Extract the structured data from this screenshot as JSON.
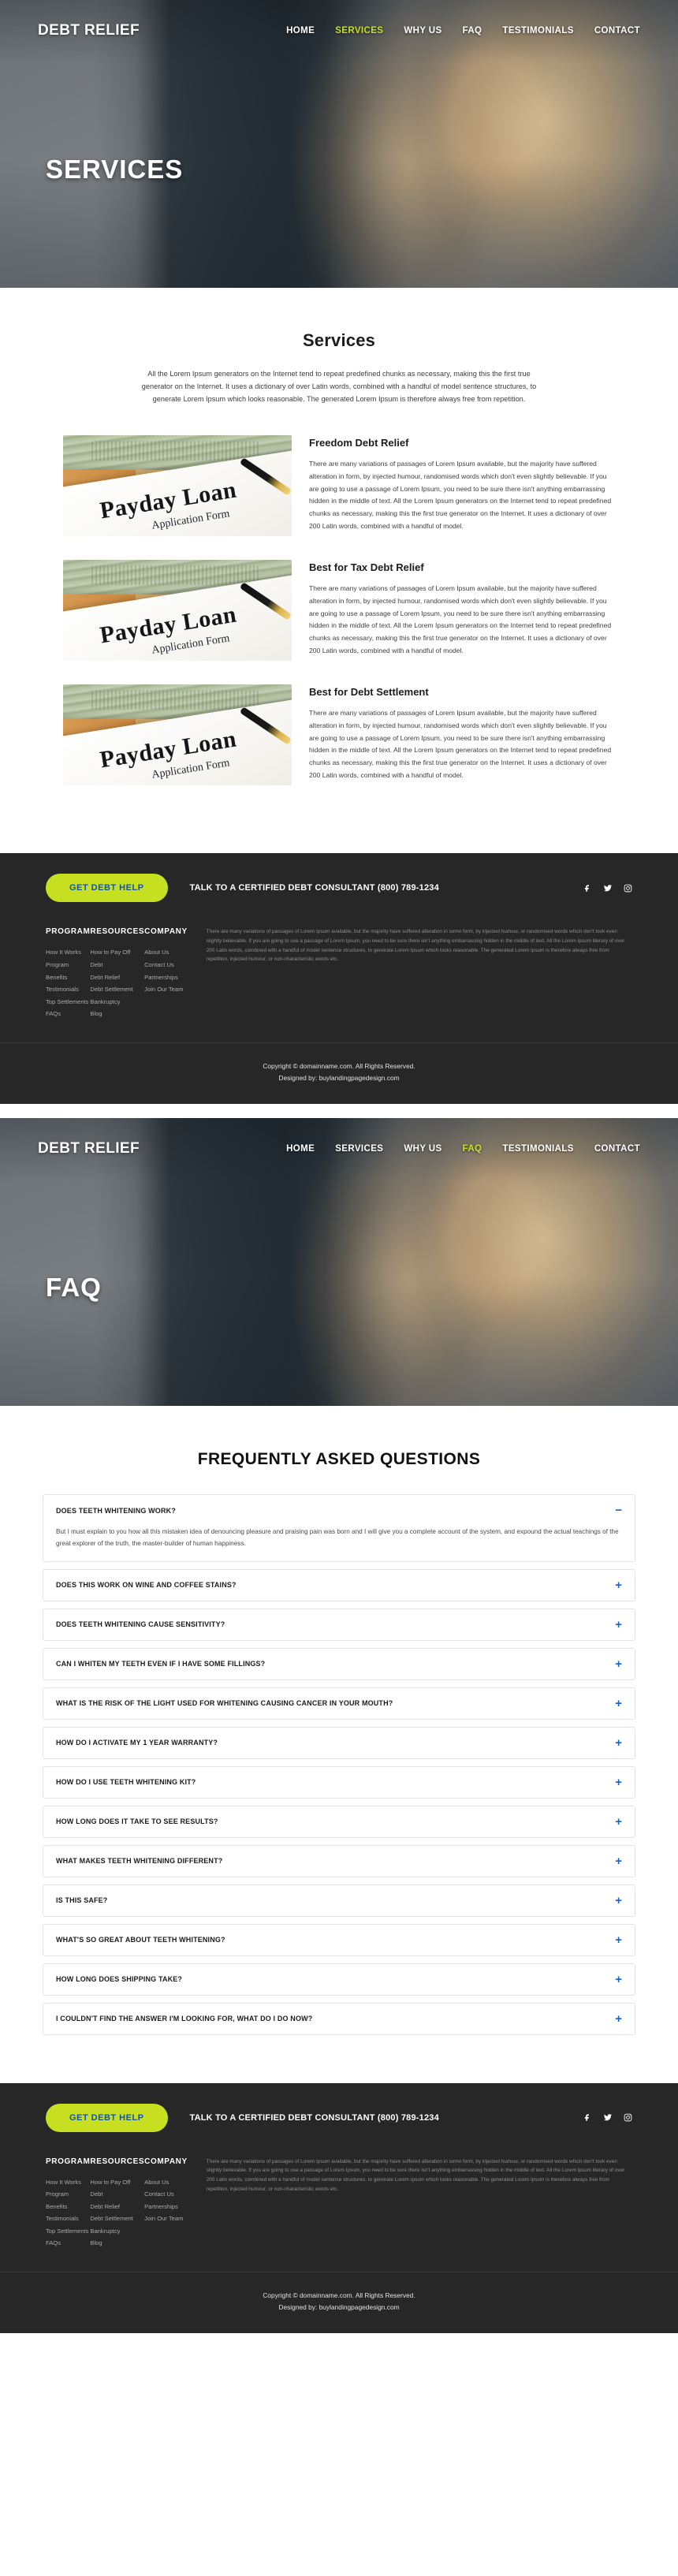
{
  "brand": {
    "logo": "DEBT RELIEF",
    "accent_color": "#c6e021",
    "link_color": "#1266d4"
  },
  "nav": {
    "items": [
      {
        "label": "HOME",
        "active": false
      },
      {
        "label": "SERVICES",
        "active": true
      },
      {
        "label": "WHY US",
        "active": false
      },
      {
        "label": "FAQ",
        "active": false
      },
      {
        "label": "TESTIMONIALS",
        "active": false
      },
      {
        "label": "CONTACT",
        "active": false
      }
    ]
  },
  "nav_faq": {
    "items": [
      {
        "label": "HOME",
        "active": false
      },
      {
        "label": "SERVICES",
        "active": false
      },
      {
        "label": "WHY US",
        "active": false
      },
      {
        "label": "FAQ",
        "active": true
      },
      {
        "label": "TESTIMONIALS",
        "active": false
      },
      {
        "label": "CONTACT",
        "active": false
      }
    ]
  },
  "hero_services": {
    "title": "SERVICES"
  },
  "hero_faq": {
    "title": "FAQ"
  },
  "services": {
    "heading": "Services",
    "intro": "All the Lorem Ipsum generators on the Internet tend to repeat predefined chunks as necessary, making this the first true generator on the Internet. It uses a dictionary of over Latin words, combined with a handful of model sentence structures, to generate Lorem Ipsum which looks reasonable. The generated Lorem Ipsum is therefore always free from repetition.",
    "image_caption_title": "Payday Loan",
    "image_caption_sub": "Application Form",
    "items": [
      {
        "title": "Freedom Debt Relief",
        "text": "There are many variations of passages of Lorem Ipsum available, but the majority have suffered alteration in form, by injected humour, randomised words which don't even slightly believable. If you are going to use a passage of Lorem Ipsum, you need to be sure there isn't anything embarrassing hidden in the middle of text. All the Lorem Ipsum generators on the Internet tend to repeat predefined chunks as necessary, making this the first true generator on the Internet. It uses a dictionary of over 200 Latin words, combined with a handful of model."
      },
      {
        "title": "Best for Tax Debt Relief",
        "text": "There are many variations of passages of Lorem Ipsum available, but the majority have suffered alteration in form, by injected humour, randomised words which don't even slightly believable. If you are going to use a passage of Lorem Ipsum, you need to be sure there isn't anything embarrassing hidden in the middle of text. All the Lorem Ipsum generators on the Internet tend to repeat predefined chunks as necessary, making this the first true generator on the Internet. It uses a dictionary of over 200 Latin words, combined with a handful of model."
      },
      {
        "title": "Best for Debt Settlement",
        "text": "There are many variations of passages of Lorem Ipsum available, but the majority have suffered alteration in form, by injected humour, randomised words which don't even slightly believable. If you are going to use a passage of Lorem Ipsum, you need to be sure there isn't anything embarrassing hidden in the middle of text. All the Lorem Ipsum generators on the Internet tend to repeat predefined chunks as necessary, making this the first true generator on the Internet. It uses a dictionary of over 200 Latin words, combined with a handful of model."
      }
    ]
  },
  "footer": {
    "cta_button": "GET DEBT HELP",
    "cta_text": "TALK TO A CERTIFIED DEBT CONSULTANT",
    "cta_phone": "(800) 789-1234",
    "socials": [
      {
        "name": "facebook-icon"
      },
      {
        "name": "twitter-icon"
      },
      {
        "name": "instagram-icon"
      }
    ],
    "columns": [
      {
        "title": "PROGRAM",
        "links": [
          "How It Works",
          "Program Benefits",
          "Testimonials",
          "Top Settlements",
          "FAQs"
        ]
      },
      {
        "title": "RESOURCES",
        "links": [
          "How to Pay Off Debt",
          "Debt Relief",
          "Debt Settlement",
          "Bankruptcy",
          "Blog"
        ]
      },
      {
        "title": "COMPANY",
        "links": [
          "About Us",
          "Contact Us",
          "Partnerships",
          "Join Our Team"
        ]
      }
    ],
    "about_text": "There are many variations of passages of Lorem Ipsum available, but the majority have suffered alteration in some form, by injected humour, or randomised words which don't look even slightly believable. If you are going to use a passage of Lorem Ipsum, you need to be sure there isn't anything embarrassing hidden in the middle of text. All the Lorem Ipsum literary of over 200 Latin words, combined with a handful of model sentence structures, to generate Lorem Ipsum which looks reasonable. The generated Lorem Ipsum is therefore always free from repetition, injected humour, or non-characteristic words etc.",
    "copyright_line1": "Copyright © domainname.com. All Rights Reserved.",
    "copyright_line2": "Designed by: buylandingpagedesign.com"
  },
  "faq": {
    "heading": "FREQUENTLY ASKED QUESTIONS",
    "expand_icon": "+",
    "collapse_icon": "−",
    "items": [
      {
        "question": "DOES TEETH WHITENING WORK?",
        "answer": "But I must explain to you how all this mistaken idea of denouncing pleasure and praising pain was born and I will give you a complete account of the system, and expound the actual teachings of the great explorer of the truth, the master-builder of human happiness.",
        "open": true
      },
      {
        "question": "DOES THIS WORK ON WINE AND COFFEE STAINS?",
        "answer": "",
        "open": false
      },
      {
        "question": "DOES TEETH WHITENING CAUSE SENSITIVITY?",
        "answer": "",
        "open": false
      },
      {
        "question": "CAN I WHITEN MY TEETH EVEN IF I HAVE SOME FILLINGS?",
        "answer": "",
        "open": false
      },
      {
        "question": "WHAT IS THE RISK OF THE LIGHT USED FOR WHITENING CAUSING CANCER IN YOUR MOUTH?",
        "answer": "",
        "open": false
      },
      {
        "question": "HOW DO I ACTIVATE MY 1 YEAR WARRANTY?",
        "answer": "",
        "open": false
      },
      {
        "question": "HOW DO I USE TEETH WHITENING KIT?",
        "answer": "",
        "open": false
      },
      {
        "question": "HOW LONG DOES IT TAKE TO SEE RESULTS?",
        "answer": "",
        "open": false
      },
      {
        "question": "WHAT MAKES TEETH WHITENING DIFFERENT?",
        "answer": "",
        "open": false
      },
      {
        "question": "IS THIS SAFE?",
        "answer": "",
        "open": false
      },
      {
        "question": "WHAT'S SO GREAT ABOUT TEETH WHITENING?",
        "answer": "",
        "open": false
      },
      {
        "question": "HOW LONG DOES SHIPPING TAKE?",
        "answer": "",
        "open": false
      },
      {
        "question": "I COULDN'T FIND THE ANSWER I'M LOOKING FOR, WHAT DO I DO NOW?",
        "answer": "",
        "open": false
      }
    ]
  }
}
